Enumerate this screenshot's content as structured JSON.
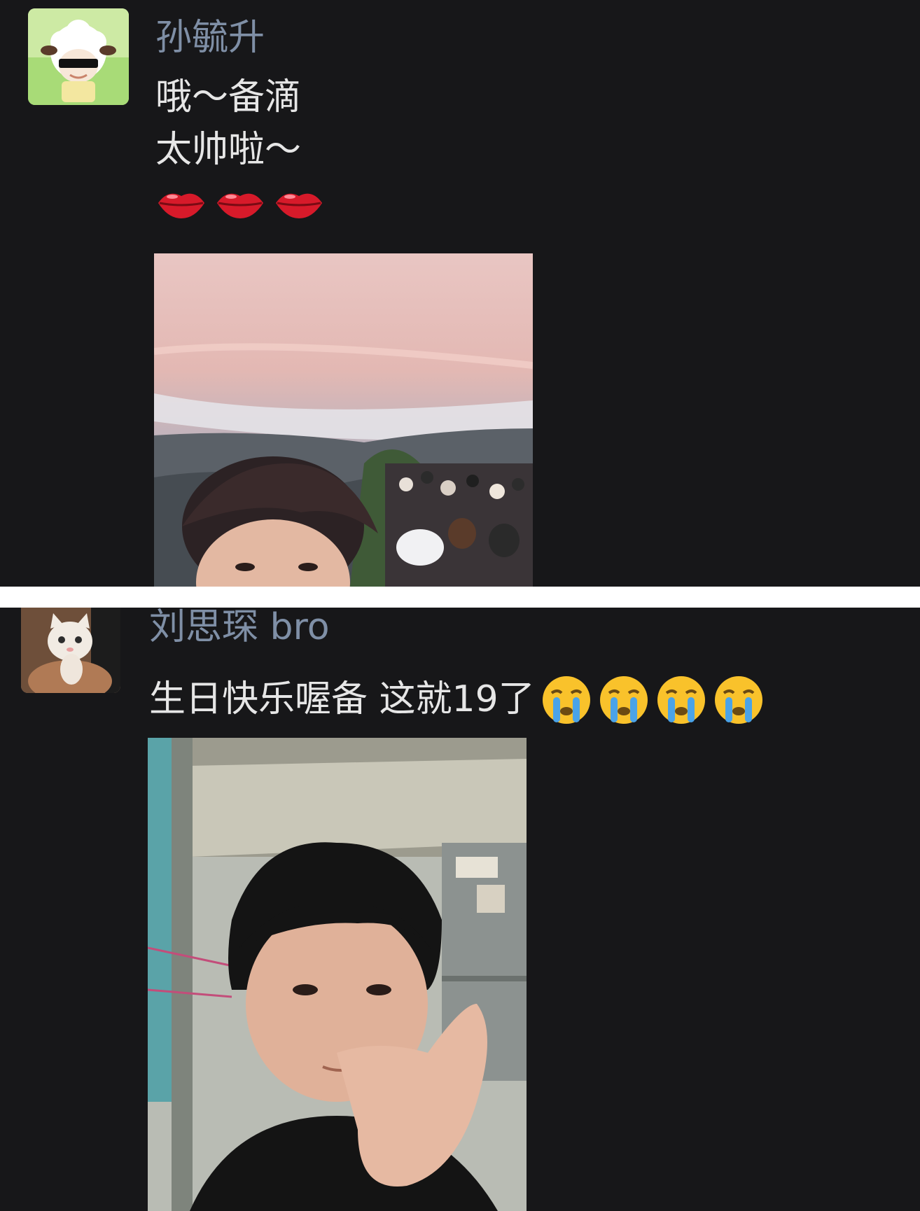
{
  "messages": [
    {
      "sender": "孙毓升",
      "lines": [
        "哦～备滴",
        "太帅啦～"
      ],
      "emojis": [
        "lips-icon",
        "lips-icon",
        "lips-icon"
      ],
      "avatar_icon": "sheep-avatar-icon",
      "photo": "selfie-mountain-sunset"
    },
    {
      "sender": "刘思琛 bro",
      "text": "生日快乐喔备 这就19了",
      "emojis": [
        "crying-face-icon",
        "crying-face-icon",
        "crying-face-icon",
        "crying-face-icon"
      ],
      "avatar_icon": "cat-avatar-icon",
      "photo": "selfie-dorm-room"
    }
  ],
  "colors": {
    "background": "#171719",
    "nickname": "#7f8fa6",
    "message_text": "#e6e6e6",
    "divider": "#ffffff"
  }
}
